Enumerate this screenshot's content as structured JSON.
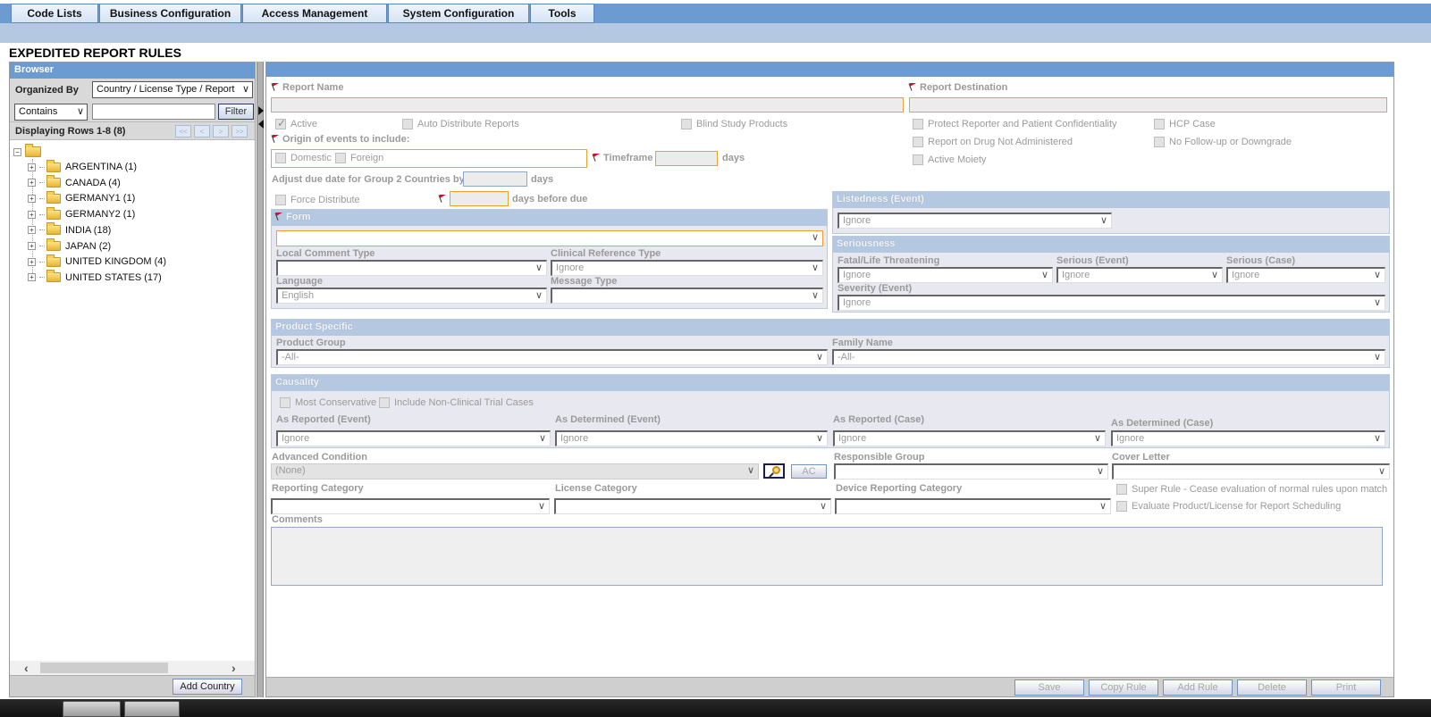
{
  "menu": {
    "items": [
      "Code Lists",
      "Business Configuration",
      "Access Management",
      "System Configuration",
      "Tools"
    ]
  },
  "page_title": "EXPEDITED REPORT RULES",
  "browser": {
    "title": "Browser",
    "organized_by_label": "Organized By",
    "organized_by_value": "Country / License Type / Report",
    "filter_mode": "Contains",
    "filter_text": "",
    "filter_button": "Filter",
    "displaying_rows": "Displaying Rows 1-8 (8)",
    "pager": [
      "<<",
      "<",
      ">",
      ">>"
    ],
    "tree_items": [
      "ARGENTINA (1)",
      "CANADA (4)",
      "GERMANY1 (1)",
      "GERMANY2 (1)",
      "INDIA (18)",
      "JAPAN (2)",
      "UNITED KINGDOM (4)",
      "UNITED STATES (17)"
    ],
    "add_country_button": "Add Country"
  },
  "form": {
    "report_name_label": "Report Name",
    "report_name_value": "",
    "report_destination_label": "Report Destination",
    "report_destination_value": "",
    "checkboxes": {
      "active": {
        "label": "Active",
        "checked": true
      },
      "auto_distribute": {
        "label": "Auto Distribute Reports",
        "checked": false
      },
      "blind_study": {
        "label": "Blind Study Products",
        "checked": false
      },
      "protect_reporter": {
        "label": "Protect Reporter and Patient Confidentiality",
        "checked": false
      },
      "hcp_case": {
        "label": "HCP Case",
        "checked": false
      },
      "drug_not_administered": {
        "label": "Report on Drug Not Administered",
        "checked": false
      },
      "no_followup": {
        "label": "No Follow-up or Downgrade",
        "checked": false
      },
      "active_moiety": {
        "label": "Active Moiety",
        "checked": false
      },
      "domestic": {
        "label": "Domestic",
        "checked": false
      },
      "foreign": {
        "label": "Foreign",
        "checked": false
      },
      "force_distribute": {
        "label": "Force Distribute",
        "checked": false
      },
      "most_conservative": {
        "label": "Most Conservative",
        "checked": false
      },
      "include_non_clinical": {
        "label": "Include Non-Clinical Trial Cases",
        "checked": false
      },
      "super_rule": {
        "label": "Super Rule - Cease evaluation of normal rules upon match",
        "checked": false
      },
      "evaluate_product_license": {
        "label": "Evaluate Product/License for Report Scheduling",
        "checked": false
      }
    },
    "origin_label": "Origin of events to include:",
    "timeframe_label": "Timeframe",
    "timeframe_value": "",
    "days_label": "days",
    "adjust_due_label": "Adjust due date for Group 2 Countries by",
    "adjust_due_value": "",
    "days_before_due_value": "",
    "days_before_due_label": "days before due",
    "form_section": {
      "title": "Form",
      "form_value": "",
      "local_comment_type_label": "Local Comment Type",
      "local_comment_type_value": "",
      "clinical_reference_type_label": "Clinical Reference Type",
      "clinical_reference_type_value": "Ignore",
      "language_label": "Language",
      "language_value": "English",
      "message_type_label": "Message Type",
      "message_type_value": ""
    },
    "listedness": {
      "title": "Listedness (Event)",
      "value": "Ignore"
    },
    "seriousness": {
      "title": "Seriousness",
      "fatal_label": "Fatal/Life Threatening",
      "fatal_value": "Ignore",
      "serious_event_label": "Serious (Event)",
      "serious_event_value": "Ignore",
      "serious_case_label": "Serious (Case)",
      "serious_case_value": "Ignore",
      "severity_label": "Severity (Event)",
      "severity_value": "Ignore"
    },
    "product_specific": {
      "title": "Product Specific",
      "product_group_label": "Product Group",
      "product_group_value": "-All-",
      "family_name_label": "Family Name",
      "family_name_value": "-All-"
    },
    "causality": {
      "title": "Causality",
      "as_reported_event_label": "As Reported (Event)",
      "as_reported_event_value": "Ignore",
      "as_determined_event_label": "As Determined (Event)",
      "as_determined_event_value": "Ignore",
      "as_reported_case_label": "As Reported (Case)",
      "as_reported_case_value": "Ignore",
      "as_determined_case_label": "As Determined (Case)",
      "as_determined_case_value": "Ignore"
    },
    "advanced_condition_label": "Advanced Condition",
    "advanced_condition_value": "(None)",
    "ac_button": "AC",
    "responsible_group_label": "Responsible Group",
    "responsible_group_value": "",
    "cover_letter_label": "Cover Letter",
    "cover_letter_value": "",
    "reporting_category_label": "Reporting Category",
    "reporting_category_value": "",
    "license_category_label": "License Category",
    "license_category_value": "",
    "device_reporting_category_label": "Device Reporting Category",
    "device_reporting_category_value": "",
    "comments_label": "Comments",
    "comments_value": ""
  },
  "footer_buttons": [
    "Save",
    "Copy Rule",
    "Add Rule",
    "Delete",
    "Print"
  ],
  "colors": {
    "menu_bar": "#6b9bd1",
    "sub_bar": "#b4c8e2",
    "required_border": "#f0a030",
    "required_flag": "#d0112b",
    "section_header": "#b4c8e2"
  }
}
